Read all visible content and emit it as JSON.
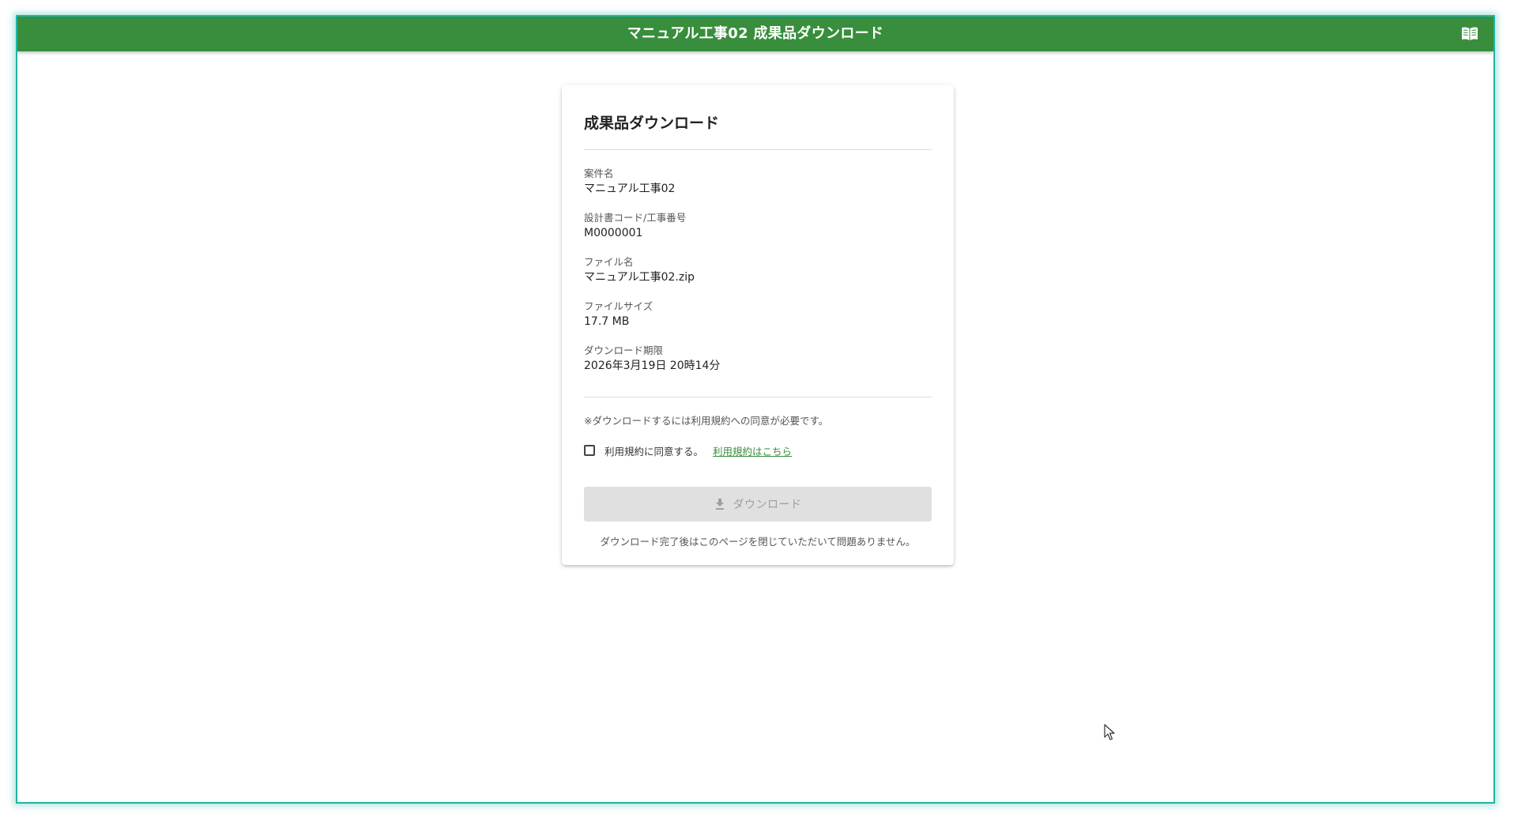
{
  "header": {
    "title": "マニュアル工事02 成果品ダウンロード",
    "manual_icon": "book-open-icon"
  },
  "card": {
    "title": "成果品ダウンロード",
    "fields": [
      {
        "label": "案件名",
        "value": "マニュアル工事02"
      },
      {
        "label": "設計書コード/工事番号",
        "value": "M0000001"
      },
      {
        "label": "ファイル名",
        "value": "マニュアル工事02.zip"
      },
      {
        "label": "ファイルサイズ",
        "value": "17.7 MB"
      },
      {
        "label": "ダウンロード期限",
        "value": "2026年3月19日 20時14分"
      }
    ],
    "notice": "※ダウンロードするには利用規約への同意が必要です。",
    "agree_label": "利用規約に同意する。",
    "agree_checked": false,
    "terms_link": "利用規約はこちら",
    "download_button": "ダウンロード",
    "download_enabled": false,
    "after_note": "ダウンロード完了後はこのページを閉じていただいて問題ありません。"
  },
  "colors": {
    "header_bg": "#388e3c",
    "link": "#388e3c",
    "button_disabled_bg": "#e0e0e0",
    "window_border": "#1fb5a6"
  }
}
